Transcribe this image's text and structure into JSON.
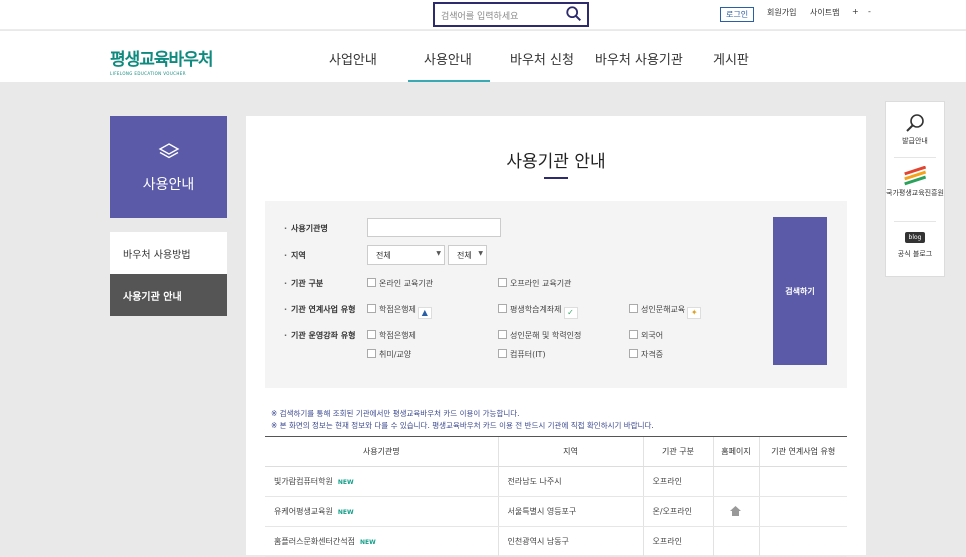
{
  "search": {
    "placeholder": "검색어를 입력하세요"
  },
  "util": {
    "login": "로그인",
    "join": "회원가입",
    "sitemap": "사이트맵",
    "plus": "+",
    "minus": "-"
  },
  "logo": {
    "text": "평생교육바우처",
    "sub": "LIFELONG EDUCATION VOUCHER"
  },
  "nav": [
    "사업안내",
    "사용안내",
    "바우처 신청",
    "바우처 사용기관",
    "게시판"
  ],
  "sidebar": {
    "title": "사용안내",
    "items": [
      {
        "label": "바우처 사용방법"
      },
      {
        "label": "사용기관 안내"
      }
    ]
  },
  "page": {
    "title": "사용기관 안내"
  },
  "form": {
    "labels": {
      "name": "사용기관명",
      "region": "지역",
      "type": "기관 구분",
      "linked": "기관 연계사업 유형",
      "course": "기관 운영강좌 유형"
    },
    "region1": "전체",
    "region2": "전체",
    "type_options": [
      "온라인 교육기관",
      "오프라인 교육기관"
    ],
    "linked_options": [
      "학점은행제",
      "평생학습계좌제",
      "성인문해교육"
    ],
    "course_options": [
      "학점은행제",
      "성인문해 및 학력인정",
      "외국어",
      "취미/교양",
      "컴퓨터(IT)",
      "자격증"
    ],
    "submit": "검색하기"
  },
  "notes": [
    "※ 검색하기를 통해 조회된 기관에서만 평생교육바우처 카드 이용이 가능합니다.",
    "※ 본 화면의 정보는 현재 정보와 다를 수 있습니다. 평생교육바우처 카드 이용 전 반드시 기관에 직접 확인하시기 바랍니다."
  ],
  "table": {
    "headers": [
      "사용기관명",
      "지역",
      "기관 구분",
      "홈페이지",
      "기관 연계사업 유형"
    ],
    "new_badge": "NEW",
    "rows": [
      {
        "name": "빛가람컴퓨터학원",
        "region": "전라남도 나주시",
        "type": "오프라인"
      },
      {
        "name": "유케어평생교육원",
        "region": "서울특별시 영등포구",
        "type": "온/오프라인"
      },
      {
        "name": "홈플러스문화센터간석점",
        "region": "인천광역시 남동구",
        "type": "오프라인"
      }
    ]
  },
  "quick": {
    "items": [
      "발급안내",
      "국가평생교육진흥원",
      "공식 블로그"
    ],
    "blog_badge": "blog"
  },
  "colors": {
    "primary": "#5a5aa8",
    "navy": "#2d2a6e",
    "teal": "#3aa9b4",
    "logo": "#0f8a7e"
  }
}
